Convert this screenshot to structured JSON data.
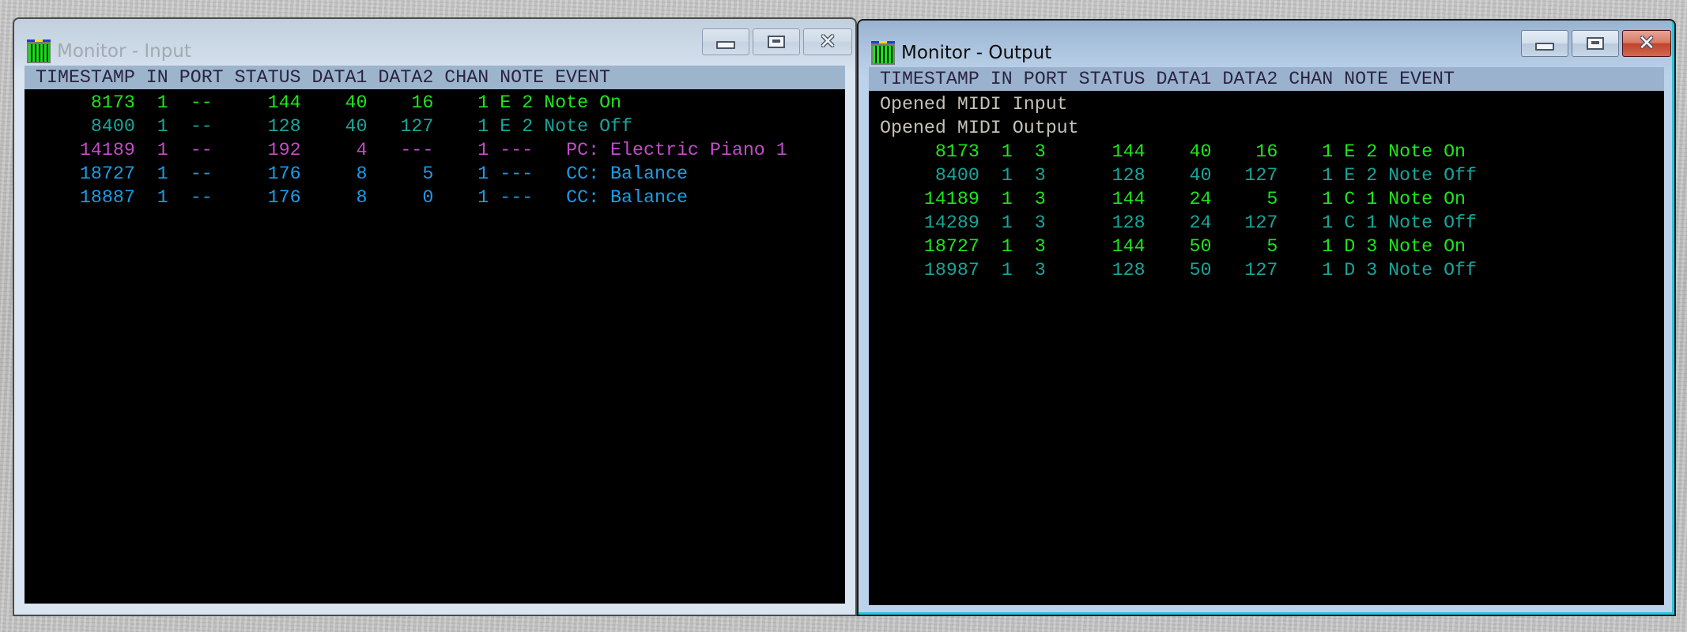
{
  "colors": {
    "note_on": "#1ee61e",
    "note_off": "#17a69a",
    "program_change": "#c04ec4",
    "control_change": "#199ee8",
    "console_bg": "#000000",
    "message": "#c7c2b8"
  },
  "columns": [
    "TIMESTAMP",
    "IN",
    "PORT",
    "STATUS",
    "DATA1",
    "DATA2",
    "CHAN",
    "NOTE",
    "EVENT"
  ],
  "header_text": "TIMESTAMP IN PORT STATUS DATA1 DATA2 CHAN NOTE EVENT",
  "windows": {
    "input": {
      "title": "Monitor - Input",
      "state": "inactive",
      "icon": "midi-monitor-icon",
      "buttons": {
        "minimize": "minimize-icon",
        "maximize": "maximize-icon",
        "close": "close-icon"
      },
      "messages": [],
      "rows": [
        {
          "kind": "note_on",
          "timestamp": "8173",
          "in": "1",
          "port": "--",
          "status": "144",
          "data1": "40",
          "data2": "16",
          "chan": "1",
          "note": "E",
          "octave": "2",
          "event": "Note On"
        },
        {
          "kind": "note_off",
          "timestamp": "8400",
          "in": "1",
          "port": "--",
          "status": "128",
          "data1": "40",
          "data2": "127",
          "chan": "1",
          "note": "E",
          "octave": "2",
          "event": "Note Off"
        },
        {
          "kind": "program_change",
          "timestamp": "14189",
          "in": "1",
          "port": "--",
          "status": "192",
          "data1": "4",
          "data2": "---",
          "chan": "1",
          "note": "---",
          "octave": "",
          "event": "PC: Electric Piano 1"
        },
        {
          "kind": "control_change",
          "timestamp": "18727",
          "in": "1",
          "port": "--",
          "status": "176",
          "data1": "8",
          "data2": "5",
          "chan": "1",
          "note": "---",
          "octave": "",
          "event": "CC: Balance"
        },
        {
          "kind": "control_change",
          "timestamp": "18887",
          "in": "1",
          "port": "--",
          "status": "176",
          "data1": "8",
          "data2": "0",
          "chan": "1",
          "note": "---",
          "octave": "",
          "event": "CC: Balance"
        }
      ]
    },
    "output": {
      "title": "Monitor - Output",
      "state": "active",
      "icon": "midi-monitor-icon",
      "buttons": {
        "minimize": "minimize-icon",
        "maximize": "maximize-icon",
        "close": "close-icon"
      },
      "messages": [
        "Opened MIDI Input",
        "Opened MIDI Output"
      ],
      "rows": [
        {
          "kind": "note_on",
          "timestamp": "8173",
          "in": "1",
          "port": "3",
          "status": "144",
          "data1": "40",
          "data2": "16",
          "chan": "1",
          "note": "E",
          "octave": "2",
          "event": "Note On"
        },
        {
          "kind": "note_off",
          "timestamp": "8400",
          "in": "1",
          "port": "3",
          "status": "128",
          "data1": "40",
          "data2": "127",
          "chan": "1",
          "note": "E",
          "octave": "2",
          "event": "Note Off"
        },
        {
          "kind": "note_on",
          "timestamp": "14189",
          "in": "1",
          "port": "3",
          "status": "144",
          "data1": "24",
          "data2": "5",
          "chan": "1",
          "note": "C",
          "octave": "1",
          "event": "Note On"
        },
        {
          "kind": "note_off",
          "timestamp": "14289",
          "in": "1",
          "port": "3",
          "status": "128",
          "data1": "24",
          "data2": "127",
          "chan": "1",
          "note": "C",
          "octave": "1",
          "event": "Note Off"
        },
        {
          "kind": "note_on",
          "timestamp": "18727",
          "in": "1",
          "port": "3",
          "status": "144",
          "data1": "50",
          "data2": "5",
          "chan": "1",
          "note": "D",
          "octave": "3",
          "event": "Note On"
        },
        {
          "kind": "note_off",
          "timestamp": "18987",
          "in": "1",
          "port": "3",
          "status": "128",
          "data1": "50",
          "data2": "127",
          "chan": "1",
          "note": "D",
          "octave": "3",
          "event": "Note Off"
        }
      ]
    }
  }
}
